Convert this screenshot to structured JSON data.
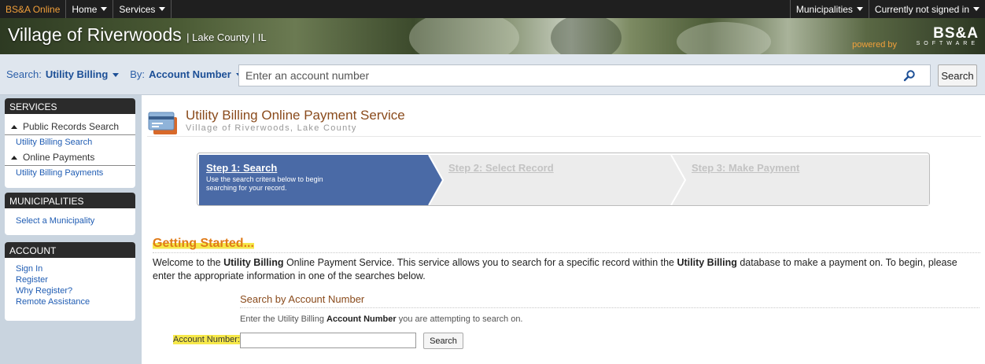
{
  "topnav": {
    "brand": "BS&A Online",
    "home": "Home",
    "services": "Services",
    "municipalities": "Municipalities",
    "signin_status": "Currently not signed in"
  },
  "banner": {
    "title": "Village of Riverwoods",
    "subtitle": "| Lake County | IL",
    "powered_by": "powered by",
    "logo_big": "BS&A",
    "logo_small": "SOFTWARE"
  },
  "search": {
    "search_label": "Search:",
    "search_value": "Utility Billing",
    "by_label": "By:",
    "by_value": "Account Number",
    "placeholder": "Enter an account number",
    "button": "Search"
  },
  "sidebar": {
    "services": {
      "header": "SERVICES",
      "group1": "Public Records Search",
      "link1": "Utility Billing Search",
      "group2": "Online Payments",
      "link2": "Utility Billing Payments"
    },
    "municipalities": {
      "header": "MUNICIPALITIES",
      "link1": "Select a Municipality"
    },
    "account": {
      "header": "ACCOUNT",
      "links": [
        "Sign In",
        "Register",
        "Why Register?",
        "Remote Assistance"
      ]
    }
  },
  "main": {
    "title": "Utility Billing Online Payment Service",
    "subtitle": "Village of Riverwoods, Lake County",
    "steps": [
      {
        "title": "Step 1: Search",
        "desc": "Use the search critera below to begin searching for your record."
      },
      {
        "title": "Step 2: Select Record",
        "desc": ""
      },
      {
        "title": "Step 3: Make Payment",
        "desc": ""
      }
    ],
    "getting_started": "Getting Started...",
    "intro": {
      "p1": "Welcome to the ",
      "b1": "Utility Billing",
      "p2": " Online Payment Service. This service allows you to search for a specific record within the ",
      "b2": "Utility Billing",
      "p3": " database to make a payment on. To begin, please enter the appropriate information in one of the searches below."
    },
    "sba": {
      "title": "Search by Account Number",
      "hint1": "Enter the Utility Billing ",
      "hint_bold": "Account Number",
      "hint2": " you are attempting to search on.",
      "label": "Account Number:",
      "button": "Search"
    }
  },
  "colors": {
    "topnav_bg": "#1f1f1f",
    "brand": "#f2a03a",
    "link": "#1f5cb3",
    "step_active": "#4a6aa6",
    "step_inactive": "#ececec",
    "title": "#8a4b1c",
    "highlight": "#f6e84a"
  }
}
